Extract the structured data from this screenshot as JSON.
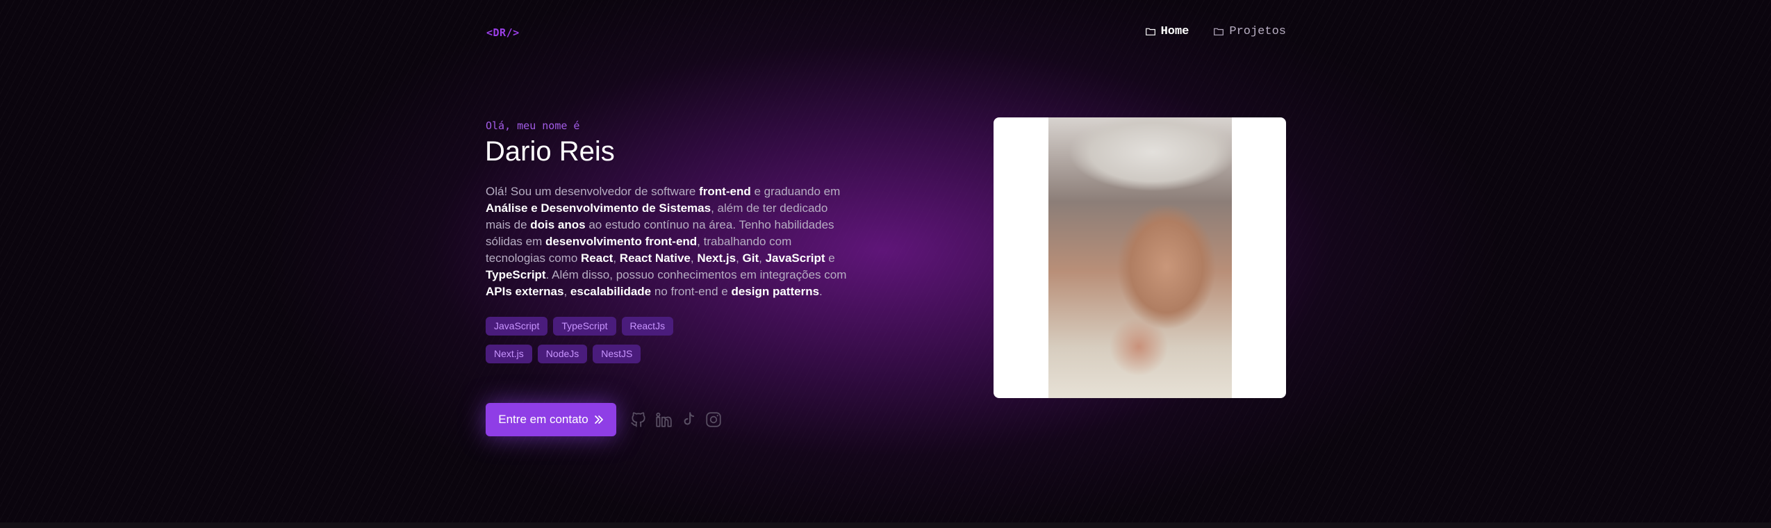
{
  "logo": {
    "open": "<",
    "text": "DR",
    "close": "/>"
  },
  "nav": [
    {
      "label": "Home",
      "active": true
    },
    {
      "label": "Projetos",
      "active": false
    }
  ],
  "hero": {
    "greeting": "Olá, meu nome é",
    "name": "Dario Reis",
    "bio": [
      {
        "t": "Olá! Sou um desenvolvedor de software ",
        "b": false
      },
      {
        "t": "front-end",
        "b": true
      },
      {
        "t": " e graduando em ",
        "b": false
      },
      {
        "t": "Análise e Desenvolvimento de Sistemas",
        "b": true
      },
      {
        "t": ", além de ter dedicado mais de ",
        "b": false
      },
      {
        "t": "dois anos",
        "b": true
      },
      {
        "t": " ao estudo contínuo na área. Tenho habilidades sólidas em ",
        "b": false
      },
      {
        "t": "desenvolvimento front-end",
        "b": true
      },
      {
        "t": ", trabalhando com tecnologias como ",
        "b": false
      },
      {
        "t": "React",
        "b": true
      },
      {
        "t": ", ",
        "b": false
      },
      {
        "t": "React Native",
        "b": true
      },
      {
        "t": ", ",
        "b": false
      },
      {
        "t": "Next.js",
        "b": true
      },
      {
        "t": ", ",
        "b": false
      },
      {
        "t": "Git",
        "b": true
      },
      {
        "t": ", ",
        "b": false
      },
      {
        "t": "JavaScript",
        "b": true
      },
      {
        "t": " e ",
        "b": false
      },
      {
        "t": "TypeScript",
        "b": true
      },
      {
        "t": ". Além disso, possuo conhecimentos em integrações com ",
        "b": false
      },
      {
        "t": "APIs externas",
        "b": true
      },
      {
        "t": ", ",
        "b": false
      },
      {
        "t": "escalabilidade",
        "b": true
      },
      {
        "t": " no front-end e ",
        "b": false
      },
      {
        "t": "design patterns",
        "b": true
      },
      {
        "t": ".",
        "b": false
      }
    ],
    "tags_row1": [
      "JavaScript",
      "TypeScript",
      "ReactJs"
    ],
    "tags_row2": [
      "Next.js",
      "NodeJs",
      "NestJS"
    ],
    "cta_label": "Entre em contato",
    "socials": [
      "github-icon",
      "linkedin-icon",
      "tiktok-icon",
      "instagram-icon"
    ]
  },
  "colors": {
    "accent": "#8f3ee6",
    "tag_bg": "#4a1c7c",
    "tag_text": "#c894ff"
  }
}
